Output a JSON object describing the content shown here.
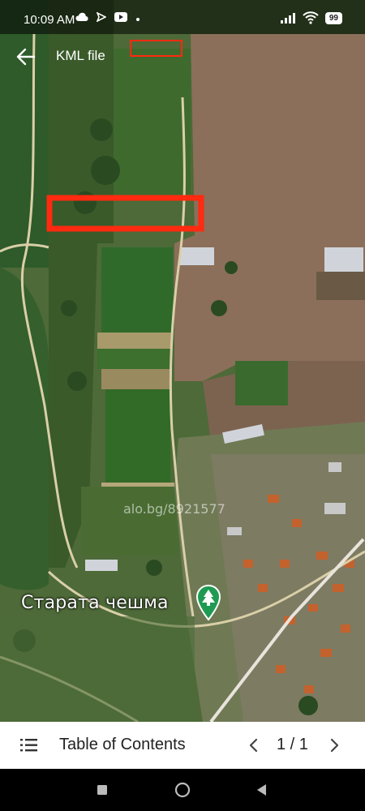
{
  "status_bar": {
    "time": "10:09 AM",
    "battery": "99"
  },
  "header": {
    "title": "KML file"
  },
  "map": {
    "place_label": "Старата чешма",
    "watermark": "alo.bg/8921577",
    "highlight_color": "#ff2a10"
  },
  "bottom_bar": {
    "toc_label": "Table of Contents",
    "page_indicator": "1 / 1"
  },
  "icons": {
    "back": "arrow-back-icon",
    "toc": "list-icon",
    "prev": "chevron-left-icon",
    "next": "chevron-right-icon",
    "place": "tree-pin-icon"
  }
}
